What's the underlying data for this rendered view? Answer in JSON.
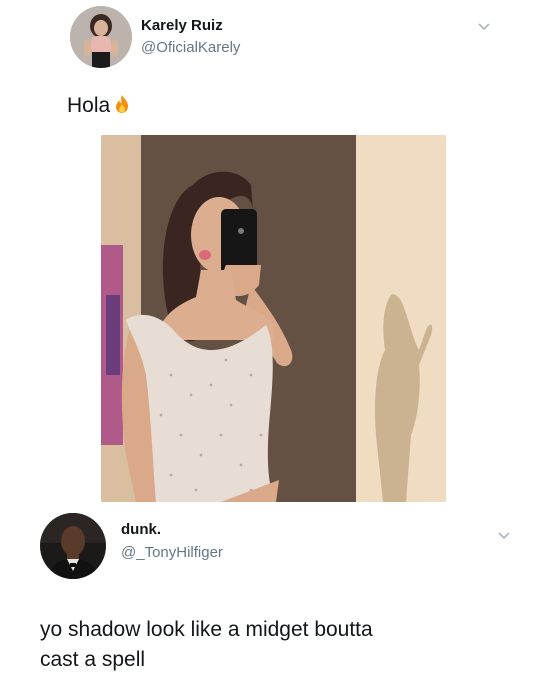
{
  "tweet1": {
    "name": "Karely Ruiz",
    "handle": "@OficialKarely",
    "text": "Hola",
    "emoji_icon": "fire-icon",
    "media_icon": "photo-mirror-selfie"
  },
  "tweet2": {
    "name": "dunk.",
    "handle": "@_TonyHilfiger",
    "text_line1": "yo shadow look like a midget boutta",
    "text_line2": "cast a spell"
  },
  "colors": {
    "name": "#14171a",
    "handle": "#657786",
    "chevron": "#aab8c2"
  }
}
